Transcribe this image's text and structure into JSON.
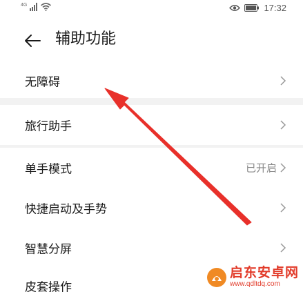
{
  "status_bar": {
    "network_type": "4G",
    "time": "17:32"
  },
  "header": {
    "title": "辅助功能"
  },
  "groups": [
    {
      "items": [
        {
          "label": "无障碍"
        }
      ]
    },
    {
      "items": [
        {
          "label": "旅行助手"
        }
      ]
    },
    {
      "items": [
        {
          "label": "单手模式",
          "value": "已开启"
        },
        {
          "label": "快捷启动及手势"
        },
        {
          "label": "智慧分屏"
        }
      ]
    },
    {
      "items": [
        {
          "label": "皮套操作"
        }
      ]
    }
  ],
  "annotation": {
    "arrow_color": "#e8302a",
    "points_to": "无障碍"
  },
  "watermark": {
    "name": "启东安卓网",
    "url": "www.qdltdq.com"
  }
}
